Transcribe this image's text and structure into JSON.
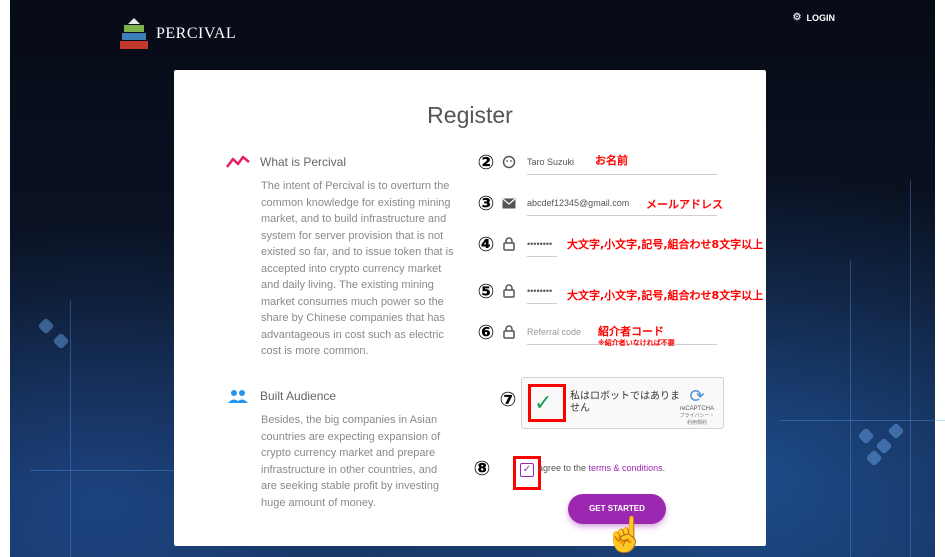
{
  "header": {
    "brand": "PERCIVAL",
    "login_label": "LOGIN"
  },
  "card": {
    "title": "Register"
  },
  "info": [
    {
      "title": "What is Percival",
      "body": "The intent of Percival is to overturn the common knowledge for existing mining market, and to build infrastructure and system for server provision that is not existed so far, and to issue token that is accepted into crypto currency market and daily living. The existing mining market consumes much power so the share by Chinese companies that has advantageous in cost such as electric cost is more common."
    },
    {
      "title": "Built Audience",
      "body": "Besides, the big companies in Asian countries are expecting expansion of crypto currency market and prepare infrastructure in other countries, and are seeking stable profit by investing huge amount of money."
    }
  ],
  "fields": {
    "name": {
      "num": "②",
      "value": "Taro Suzuki",
      "note": "お名前"
    },
    "email": {
      "num": "③",
      "value": "abcdef12345@gmail.com",
      "note": "メールアドレス"
    },
    "password": {
      "num": "④",
      "value": "••••••••",
      "note": "大文字,小文字,記号,組合わせ8文字以上"
    },
    "password_confirm": {
      "num": "⑤",
      "value": "••••••••",
      "note": "大文字,小文字,記号,組合わせ8文字以上"
    },
    "referral": {
      "num": "⑥",
      "placeholder": "Referral code",
      "note": "紹介者コード",
      "note_sub": "※紹介者いなければ不要"
    }
  },
  "recaptcha": {
    "num": "⑦",
    "label": "私はロボットではありません",
    "brand": "reCAPTCHA",
    "links": "プライバシー・利用規約"
  },
  "agree": {
    "num": "⑧",
    "text": "agree to the ",
    "link": "terms & conditions",
    "end": "."
  },
  "submit_label": "GET STARTED",
  "colors": {
    "accent": "#9c27b0",
    "annotation": "#ff0000"
  },
  "icons": {
    "info1": "trend-line-icon",
    "info2": "people-icon",
    "name": "face-icon",
    "email": "mail-icon",
    "password": "lock-icon",
    "referral": "lock-icon"
  }
}
